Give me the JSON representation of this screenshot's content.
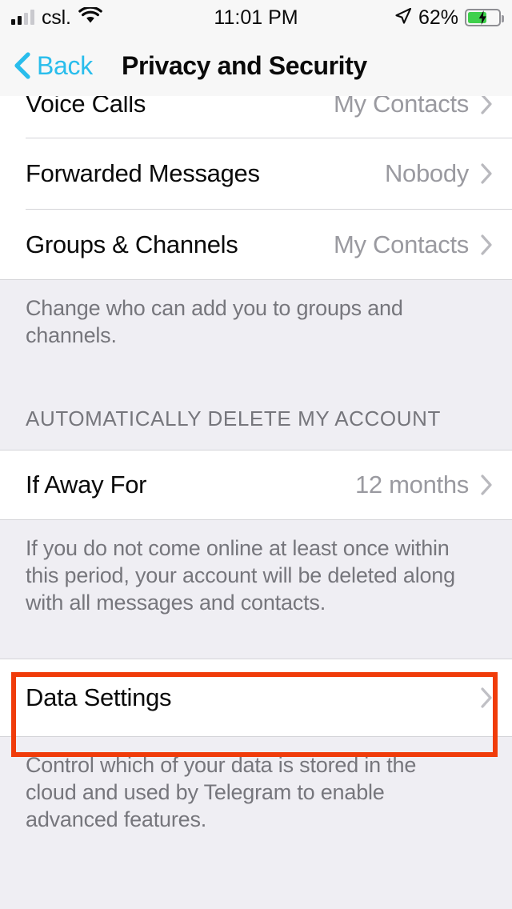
{
  "status_bar": {
    "carrier": "csl.",
    "time": "11:01 PM",
    "battery_percent": "62%",
    "battery_level": 62,
    "signal_bars_filled": 2,
    "signal_bars_total": 4,
    "icons": [
      "cellular-signal-icon",
      "wifi-icon",
      "location-arrow-icon",
      "battery-charging-icon"
    ]
  },
  "nav_bar": {
    "back_label": "Back",
    "title": "Privacy and Security"
  },
  "colors": {
    "accent_blue": "#29bdec",
    "highlight_red": "#f03c0a",
    "page_background": "#efeef3",
    "row_background": "#ffffff",
    "secondary_text": "#9a9aa0",
    "footer_text": "#76767c",
    "battery_green": "#3fd04c"
  },
  "sections": [
    {
      "name": "privacy-rows",
      "rows": [
        {
          "title": "Voice Calls",
          "value": "My Contacts",
          "clipped": true
        },
        {
          "title": "Forwarded Messages",
          "value": "Nobody",
          "clipped": false
        },
        {
          "title": "Groups & Channels",
          "value": "My Contacts",
          "clipped": false
        }
      ],
      "footer": "Change who can add you to groups and channels."
    },
    {
      "name": "auto-delete",
      "header": "AUTOMATICALLY DELETE MY ACCOUNT",
      "rows": [
        {
          "title": "If Away For",
          "value": "12 months"
        }
      ],
      "footer": "If you do not come online at least once within this period, your account will be deleted along with all messages and contacts."
    },
    {
      "name": "data-settings",
      "rows": [
        {
          "title": "Data Settings",
          "value": ""
        }
      ],
      "footer": "Control which of your data is stored in the cloud and used by Telegram to enable advanced features.",
      "highlighted": true
    }
  ]
}
